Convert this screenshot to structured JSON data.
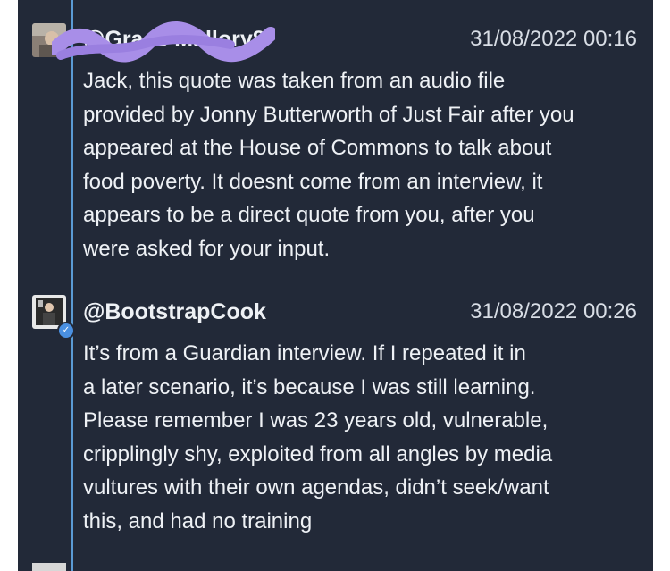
{
  "comments": [
    {
      "username": "@Grace Mallory8",
      "timestamp": "31/08/2022 00:16",
      "lines": [
        "Jack, this quote was taken from an audio file",
        "provided by Jonny Butterworth of Just Fair after you",
        "appeared at the House of Commons to talk about",
        "food poverty. It doesnt come from an interview, it",
        "appears to be a direct quote from you, after you",
        "were asked for your input."
      ],
      "avatar_icon": "user-avatar-icon",
      "redaction_color": "#a88ee8"
    },
    {
      "username": "@BootstrapCook",
      "timestamp": "31/08/2022 00:26",
      "lines": [
        "It’s from a Guardian interview. If I repeated it in",
        "a later scenario, it’s because I was still learning.",
        "Please remember I was 23 years old, vulnerable,",
        "cripplingly shy, exploited from all angles by media",
        "vultures with their own agendas, didn’t seek/want",
        "this, and had no training"
      ],
      "avatar_icon": "user-avatar-icon",
      "badge_icon": "verified-check-icon"
    }
  ],
  "colors": {
    "background": "#222938",
    "thread_line": "#5b9bd5",
    "text": "#eef1f5"
  }
}
